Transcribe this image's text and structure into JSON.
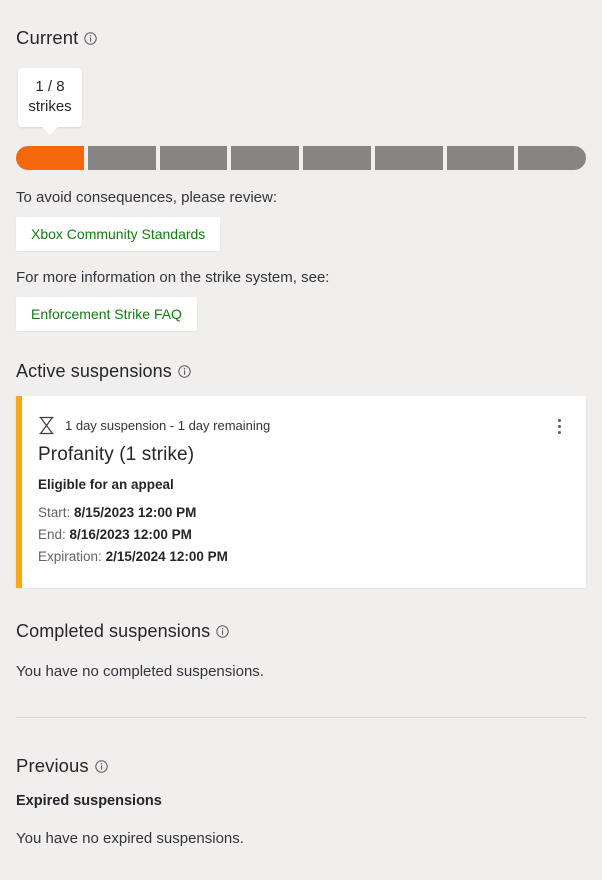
{
  "current": {
    "heading": "Current",
    "info_icon": "info-circle-icon",
    "tooltip": {
      "count_line": "1 / 8",
      "label_line": "strikes"
    },
    "strikes": {
      "total": 8,
      "used": 1,
      "filled_color": "#f4670b",
      "empty_color": "#878583"
    },
    "review_prompt": "To avoid consequences, please review:",
    "review_link_label": "Xbox Community Standards",
    "faq_prompt": "For more information on the strike system, see:",
    "faq_link_label": "Enforcement Strike FAQ",
    "link_color": "#107c10"
  },
  "active_suspensions": {
    "heading": "Active suspensions",
    "info_icon": "info-circle-icon",
    "accent_color": "#f8a81b",
    "items": [
      {
        "icon": "hourglass-icon",
        "meta": "1 day suspension - 1 day remaining",
        "title": "Profanity (1 strike)",
        "appeal_status": "Eligible for an appeal",
        "menu_icon": "kebab-menu-icon",
        "dates": [
          {
            "label": "Start:",
            "value": "8/15/2023 12:00 PM"
          },
          {
            "label": "End:",
            "value": "8/16/2023 12:00 PM"
          },
          {
            "label": "Expiration:",
            "value": "2/15/2024 12:00 PM"
          }
        ]
      }
    ]
  },
  "completed_suspensions": {
    "heading": "Completed suspensions",
    "info_icon": "info-circle-icon",
    "empty_message": "You have no completed suspensions."
  },
  "previous": {
    "heading": "Previous",
    "info_icon": "info-circle-icon",
    "expired_subheading": "Expired suspensions",
    "expired_empty_message": "You have no expired suspensions."
  }
}
